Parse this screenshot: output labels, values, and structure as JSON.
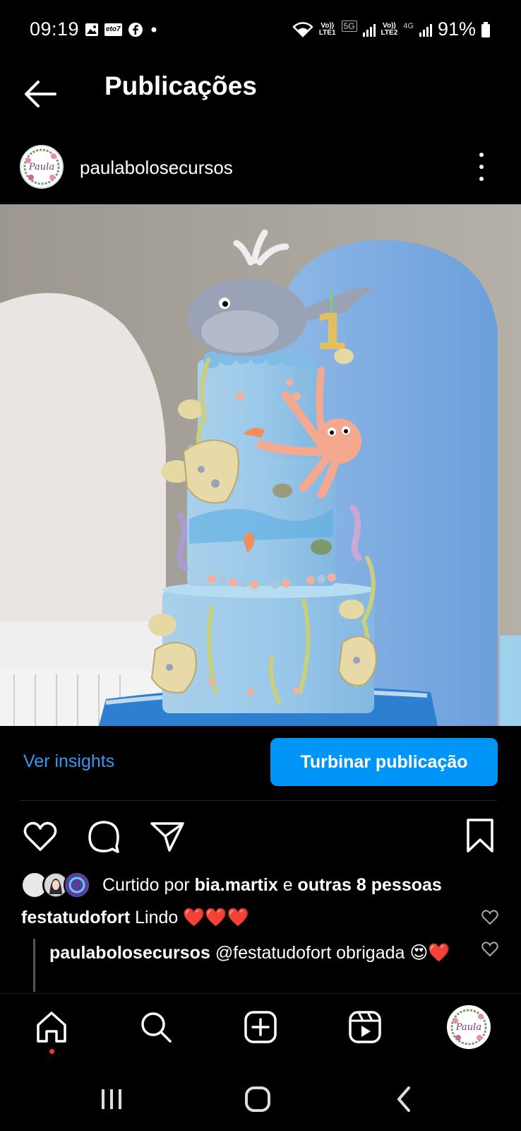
{
  "status_bar": {
    "time": "09:19",
    "notification_icons": [
      "image-icon",
      "eto-app-icon",
      "facebook-icon",
      "dot-icon"
    ],
    "eto_label": "eto7",
    "net_5g": "5G",
    "lte1": "LTE1",
    "lte2": "LTE2",
    "net_4g": "4G",
    "volte": "Vo))",
    "battery": "91%"
  },
  "header": {
    "title": "Publicações"
  },
  "post": {
    "username": "paulabolosecursos",
    "avatar_text": "Paula",
    "image_subject": "Bolo de três andares com tema fundo do mar",
    "cake_topper_number": "1"
  },
  "insights": {
    "link_label": "Ver insights",
    "boost_label": "Turbinar publicação"
  },
  "likes": {
    "prefix": "Curtido por",
    "user": "bia.martix",
    "connector": "e",
    "others": "outras 8 pessoas"
  },
  "comments": [
    {
      "user": "festatudofort",
      "text": "Lindo ❤️❤️❤️"
    }
  ],
  "replies": [
    {
      "user": "paulabolosecursos",
      "text": "@festatudofort obrigada 😍❤️"
    }
  ],
  "bottom_nav": [
    "home-icon",
    "search-icon",
    "create-icon",
    "reels-icon",
    "profile-avatar"
  ],
  "colors": {
    "background": "#000000",
    "link_blue": "#3797f0",
    "boost_blue": "#0095f6",
    "notification_red": "#ff3040"
  }
}
